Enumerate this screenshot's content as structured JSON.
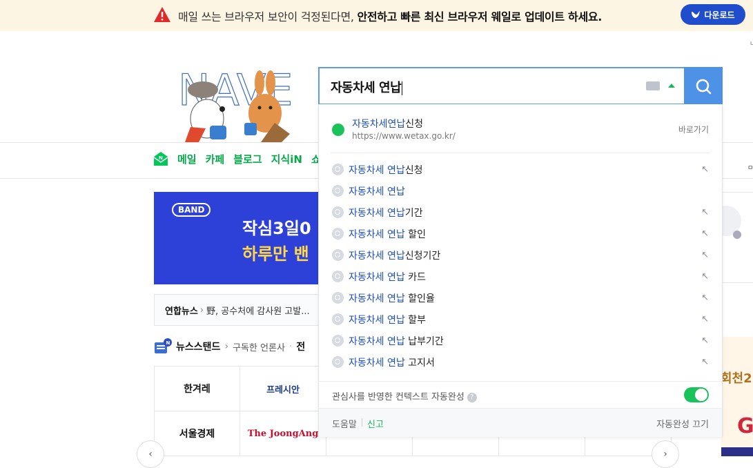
{
  "banner": {
    "text_plain": "매일 쓰는 브라우저 보안이 걱정된다면, ",
    "text_bold": "안전하고 빠른 최신 브라우저 웨일로 업데이트 하세요.",
    "download_label": "다운로드"
  },
  "logo": {
    "text": "NAVER"
  },
  "search": {
    "query": "자동차세 연납"
  },
  "nav": {
    "items": [
      "메일",
      "카페",
      "블로그",
      "지식iN",
      "쇼"
    ]
  },
  "autocomplete": {
    "site": {
      "name_hl": "자동차세연납",
      "name_rest": "신청",
      "url": "https://www.wetax.go.kr/",
      "go_label": "바로가기"
    },
    "suggestions": [
      {
        "hl": "자동차세 연납",
        "rest": "신청",
        "arrow": true
      },
      {
        "hl": "자동차세 연납",
        "rest": "",
        "arrow": false
      },
      {
        "hl": "자동차세 연납",
        "rest": "기간",
        "arrow": true
      },
      {
        "hl": "자동차세 연납",
        "rest": " 할인",
        "arrow": true
      },
      {
        "hl": "자동차세 연납",
        "rest": "신청기간",
        "arrow": true
      },
      {
        "hl": "자동차세 연납",
        "rest": " 카드",
        "arrow": true
      },
      {
        "hl": "자동차세 연납",
        "rest": " 할인율",
        "arrow": true
      },
      {
        "hl": "자동차세 연납",
        "rest": " 할부",
        "arrow": true
      },
      {
        "hl": "자동차세 연납",
        "rest": " 납부기간",
        "arrow": true
      },
      {
        "hl": "자동차세 연납",
        "rest": " 고지서",
        "arrow": true
      }
    ],
    "context_label": "관심사를 반영한 컨텍스트 자동완성",
    "context_enabled": true,
    "footer": {
      "help": "도움말",
      "report": "신고",
      "off": "자동완성 끄기"
    }
  },
  "ad": {
    "band_logo": "BAND",
    "line1": "작심3일0",
    "line2": "하루만 밴"
  },
  "news": {
    "source": "연합뉴스",
    "headline": "野, 공수처에 감사원 고발..."
  },
  "newsstand": {
    "title": "뉴스스탠드",
    "subscribed": "구독한 언론사",
    "all": "전"
  },
  "press": [
    "한겨레",
    "프레시안",
    "서울경제",
    "The JoongAng"
  ],
  "right_ad": {
    "text": "회천2",
    "letter": "G"
  },
  "colors": {
    "naver_green": "#03c75a",
    "search_blue": "#4d92e6",
    "whale_blue": "#1f4dcc"
  }
}
